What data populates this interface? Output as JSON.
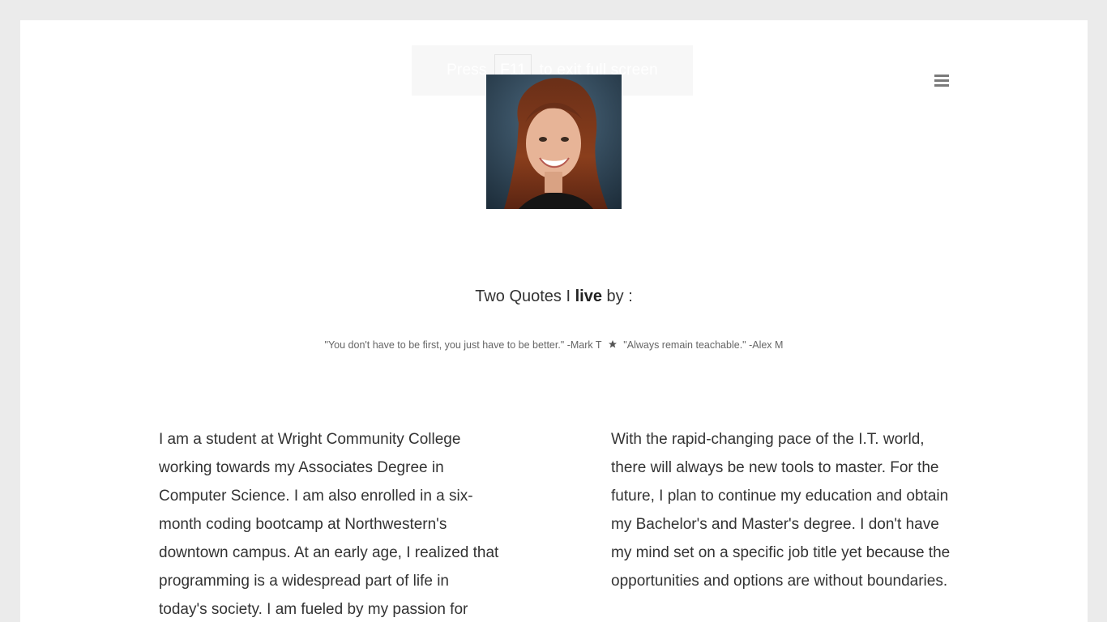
{
  "fullscreen_prompt": {
    "before_key": "Press",
    "key": "F11",
    "after_key": "to exit full screen"
  },
  "nav": {
    "menu_icon": "hamburger-menu-icon"
  },
  "profile": {
    "avatar_icon": "profile-photo"
  },
  "quotes_section": {
    "heading_before": "Two Quotes I",
    "heading_bold": "live",
    "heading_after": "by :",
    "quote_one": "\"You don't have to be first, you just have to be better.\" -Mark T",
    "separator_icon": "star-icon",
    "quote_two": "\"Always remain teachable.\" -Alex M"
  },
  "about": {
    "left_paragraph": "I am a student at Wright Community College working towards my Associates Degree in Computer Science. I am also enrolled in a six-month coding bootcamp at Northwestern's downtown campus. At an early age, I realized that programming is a widespread part of life in today's society. I am fueled by my passion for",
    "right_paragraph": "With the rapid-changing pace of the I.T. world, there will always be new tools to master. For the future, I plan to continue my education and obtain my Bachelor's and Master's degree. I don't have my mind set on a specific job title yet because the opportunities and options are without boundaries."
  },
  "colors": {
    "page_background": "#ebebeb",
    "content_background": "#ffffff",
    "text": "#333333",
    "muted_text": "#666666"
  }
}
